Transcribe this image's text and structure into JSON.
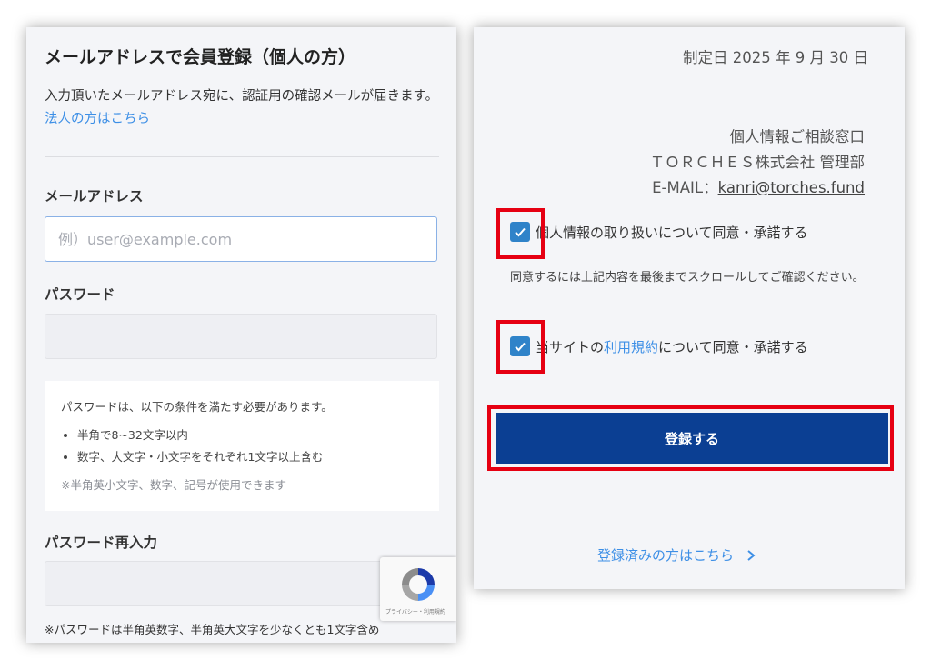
{
  "signup": {
    "title": "メールアドレスで会員登録（個人の方）",
    "description": "入力頂いたメールアドレス宛に、認証用の確認メールが届きます。",
    "corporate_link": "法人の方はこちら",
    "email_label": "メールアドレス",
    "email_placeholder": "例）user@example.com",
    "password_label": "パスワード",
    "password_rules": {
      "intro": "パスワードは、以下の条件を満たす必要があります。",
      "items": [
        "半角で8~32文字以内",
        "数字、大文字・小文字をそれぞれ1文字以上含む"
      ],
      "note": "※半角英小文字、数字、記号が使用できます"
    },
    "password_confirm_label": "パスワード再入力",
    "footnote": "※パスワードは半角英数字、半角英大文字を少なくとも1文字含め",
    "recaptcha_text": "プライバシー・利用規約"
  },
  "consent": {
    "date": "制定日 2025 年 9 月 30 日",
    "contact_title": "個人情報ご相談窓口",
    "company": "ＴＯＲＣＨＥＳ株式会社 管理部",
    "email_prefix": "E-MAIL：",
    "email": "kanri@torches.fund",
    "privacy_checkbox": "個人情報の取り扱いについて同意・承諾する",
    "scroll_note": "同意するには上記内容を最後までスクロールしてご確認ください。",
    "terms_prefix": "当サイトの",
    "terms_link": "利用規約",
    "terms_suffix": "について同意・承諾する",
    "submit_label": "登録する",
    "login_link": "登録済みの方はこちら"
  },
  "colors": {
    "accent": "#0b3f93",
    "link": "#3d8fe6",
    "highlight": "#e60012",
    "checkbox": "#2f83c9"
  },
  "icons": {
    "check": "check-icon",
    "chevron": "chevron-right-icon",
    "captcha": "recaptcha-icon"
  }
}
